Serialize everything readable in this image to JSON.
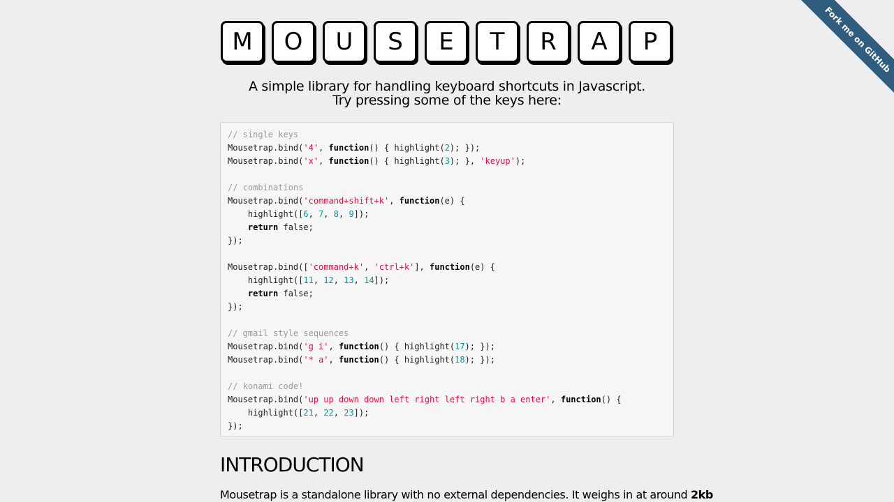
{
  "title_keys": [
    "M",
    "O",
    "U",
    "S",
    "E",
    "T",
    "R",
    "A",
    "P"
  ],
  "tagline": {
    "line1": "A simple library for handling keyboard shortcuts in Javascript.",
    "line2": "Try pressing some of the keys here:"
  },
  "code_lines": [
    [
      {
        "t": "// single keys",
        "c": "c"
      }
    ],
    [
      {
        "t": "Mousetrap.bind("
      },
      {
        "t": "'4'",
        "c": "s"
      },
      {
        "t": ", "
      },
      {
        "t": "function",
        "c": "k"
      },
      {
        "t": "() { highlight("
      },
      {
        "t": "2",
        "c": "n"
      },
      {
        "t": "); });"
      }
    ],
    [
      {
        "t": "Mousetrap.bind("
      },
      {
        "t": "'x'",
        "c": "s"
      },
      {
        "t": ", "
      },
      {
        "t": "function",
        "c": "k"
      },
      {
        "t": "() { highlight("
      },
      {
        "t": "3",
        "c": "n"
      },
      {
        "t": "); }, "
      },
      {
        "t": "'keyup'",
        "c": "s"
      },
      {
        "t": ");"
      }
    ],
    [],
    [
      {
        "t": "// combinations",
        "c": "c"
      }
    ],
    [
      {
        "t": "Mousetrap.bind("
      },
      {
        "t": "'command+shift+k'",
        "c": "s"
      },
      {
        "t": ", "
      },
      {
        "t": "function",
        "c": "k"
      },
      {
        "t": "(e) {"
      }
    ],
    [
      {
        "t": "    highlight(["
      },
      {
        "t": "6",
        "c": "n"
      },
      {
        "t": ", "
      },
      {
        "t": "7",
        "c": "n"
      },
      {
        "t": ", "
      },
      {
        "t": "8",
        "c": "n"
      },
      {
        "t": ", "
      },
      {
        "t": "9",
        "c": "n"
      },
      {
        "t": "]);"
      }
    ],
    [
      {
        "t": "    "
      },
      {
        "t": "return",
        "c": "k"
      },
      {
        "t": " false;"
      }
    ],
    [
      {
        "t": "});"
      }
    ],
    [],
    [
      {
        "t": "Mousetrap.bind(["
      },
      {
        "t": "'command+k'",
        "c": "s"
      },
      {
        "t": ", "
      },
      {
        "t": "'ctrl+k'",
        "c": "s"
      },
      {
        "t": "], "
      },
      {
        "t": "function",
        "c": "k"
      },
      {
        "t": "(e) {"
      }
    ],
    [
      {
        "t": "    highlight(["
      },
      {
        "t": "11",
        "c": "n"
      },
      {
        "t": ", "
      },
      {
        "t": "12",
        "c": "n"
      },
      {
        "t": ", "
      },
      {
        "t": "13",
        "c": "n"
      },
      {
        "t": ", "
      },
      {
        "t": "14",
        "c": "n"
      },
      {
        "t": "]);"
      }
    ],
    [
      {
        "t": "    "
      },
      {
        "t": "return",
        "c": "k"
      },
      {
        "t": " false;"
      }
    ],
    [
      {
        "t": "});"
      }
    ],
    [],
    [
      {
        "t": "// gmail style sequences",
        "c": "c"
      }
    ],
    [
      {
        "t": "Mousetrap.bind("
      },
      {
        "t": "'g i'",
        "c": "s"
      },
      {
        "t": ", "
      },
      {
        "t": "function",
        "c": "k"
      },
      {
        "t": "() { highlight("
      },
      {
        "t": "17",
        "c": "n"
      },
      {
        "t": "); });"
      }
    ],
    [
      {
        "t": "Mousetrap.bind("
      },
      {
        "t": "'* a'",
        "c": "s"
      },
      {
        "t": ", "
      },
      {
        "t": "function",
        "c": "k"
      },
      {
        "t": "() { highlight("
      },
      {
        "t": "18",
        "c": "n"
      },
      {
        "t": "); });"
      }
    ],
    [],
    [
      {
        "t": "// konami code!",
        "c": "c"
      }
    ],
    [
      {
        "t": "Mousetrap.bind("
      },
      {
        "t": "'up up down down left right left right b a enter'",
        "c": "s"
      },
      {
        "t": ", "
      },
      {
        "t": "function",
        "c": "k"
      },
      {
        "t": "() {"
      }
    ],
    [
      {
        "t": "    highlight(["
      },
      {
        "t": "21",
        "c": "n"
      },
      {
        "t": ", "
      },
      {
        "t": "22",
        "c": "n"
      },
      {
        "t": ", "
      },
      {
        "t": "23",
        "c": "n"
      },
      {
        "t": "]);"
      }
    ],
    [
      {
        "t": "});"
      }
    ]
  ],
  "section": {
    "heading": "INTRODUCTION",
    "intro_text": "Mousetrap is a standalone library with no external dependencies. It weighs in at around ",
    "intro_bold": "2kb"
  },
  "ribbon": {
    "label": "Fork me on GitHub"
  },
  "colors": {
    "ribbon": "#2e5d7d",
    "string": "#dd1144",
    "number": "#009999",
    "comment": "#999999"
  }
}
